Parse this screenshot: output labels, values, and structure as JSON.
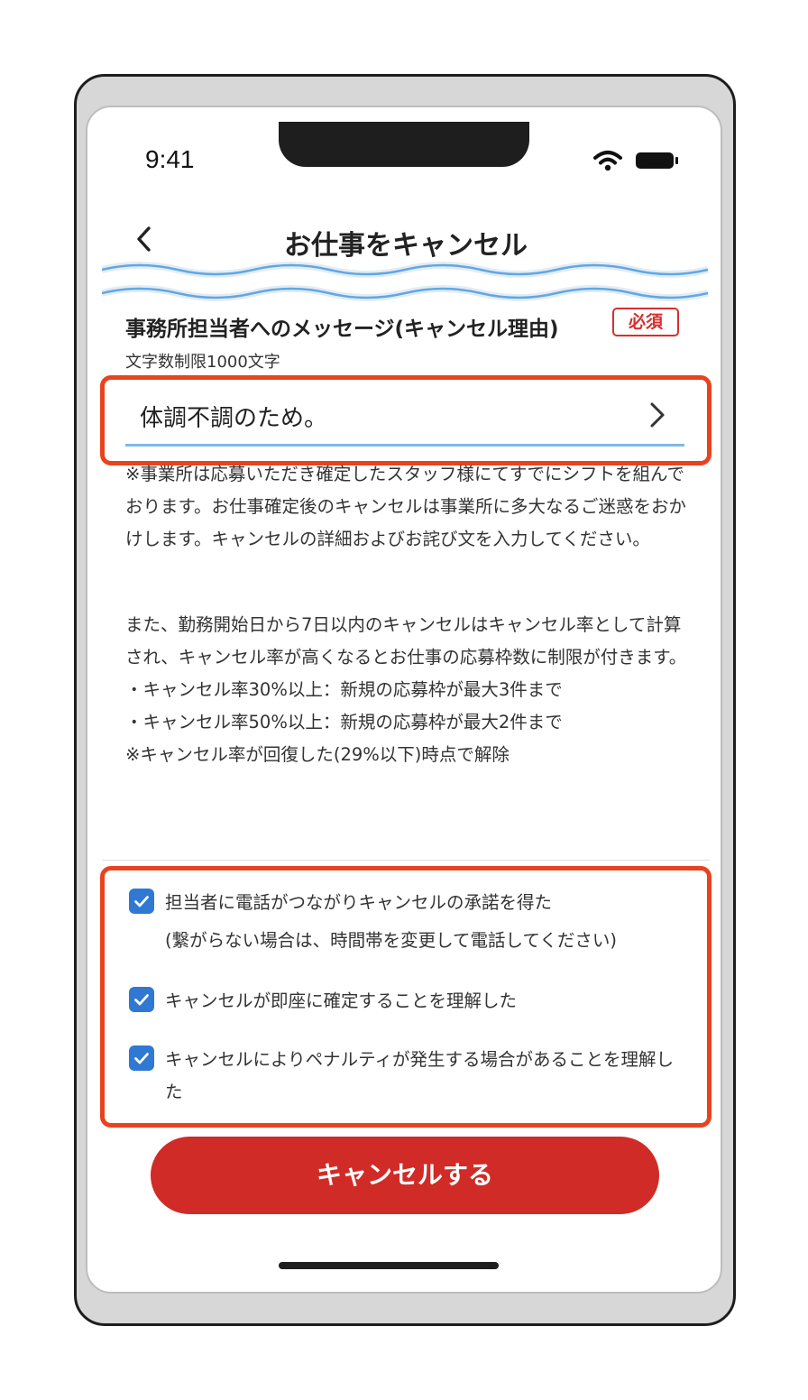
{
  "status_bar": {
    "time": "9:41",
    "wifi_icon": "wifi-icon",
    "battery_icon": "battery-icon"
  },
  "nav": {
    "back_icon": "chevron-left-icon",
    "title": "お仕事をキャンセル"
  },
  "message": {
    "title": "事務所担当者へのメッセージ(キャンセル理由)",
    "required_badge": "必須",
    "char_limit": "文字数制限1000文字",
    "value": "体調不調のため。"
  },
  "notice": {
    "text": "※事業所は応募いただき確定したスタッフ様にてすでにシフトを組んでおります。お仕事確定後のキャンセルは事業所に多大なるご迷惑をおかけします。キャンセルの詳細およびお詫び文を入力してください。"
  },
  "rules": {
    "intro": "また、勤務開始日から7日以内のキャンセルはキャンセル率として計算され、キャンセル率が高くなるとお仕事の応募枠数に制限が付きます。",
    "items": [
      "・キャンセル率30%以上：新規の応募枠が最大3件まで",
      "・キャンセル率50%以上：新規の応募枠が最大2件まで"
    ],
    "footnote": "※キャンセル率が回復した(29%以下)時点で解除"
  },
  "checks": [
    {
      "label": "担当者に電話がつながりキャンセルの承諾を得た",
      "sub": "(繋がらない場合は、時間帯を変更して電話してください)",
      "checked": true
    },
    {
      "label": "キャンセルが即座に確定することを理解した",
      "checked": true
    },
    {
      "label": "キャンセルによりペナルティが発生する場合があることを理解した",
      "checked": true
    }
  ],
  "cancel_button": "キャンセルする",
  "colors": {
    "accent_blue": "#2f78d4",
    "danger_red": "#d12b27",
    "highlight": "#e8431f",
    "required": "#d62f2f"
  }
}
